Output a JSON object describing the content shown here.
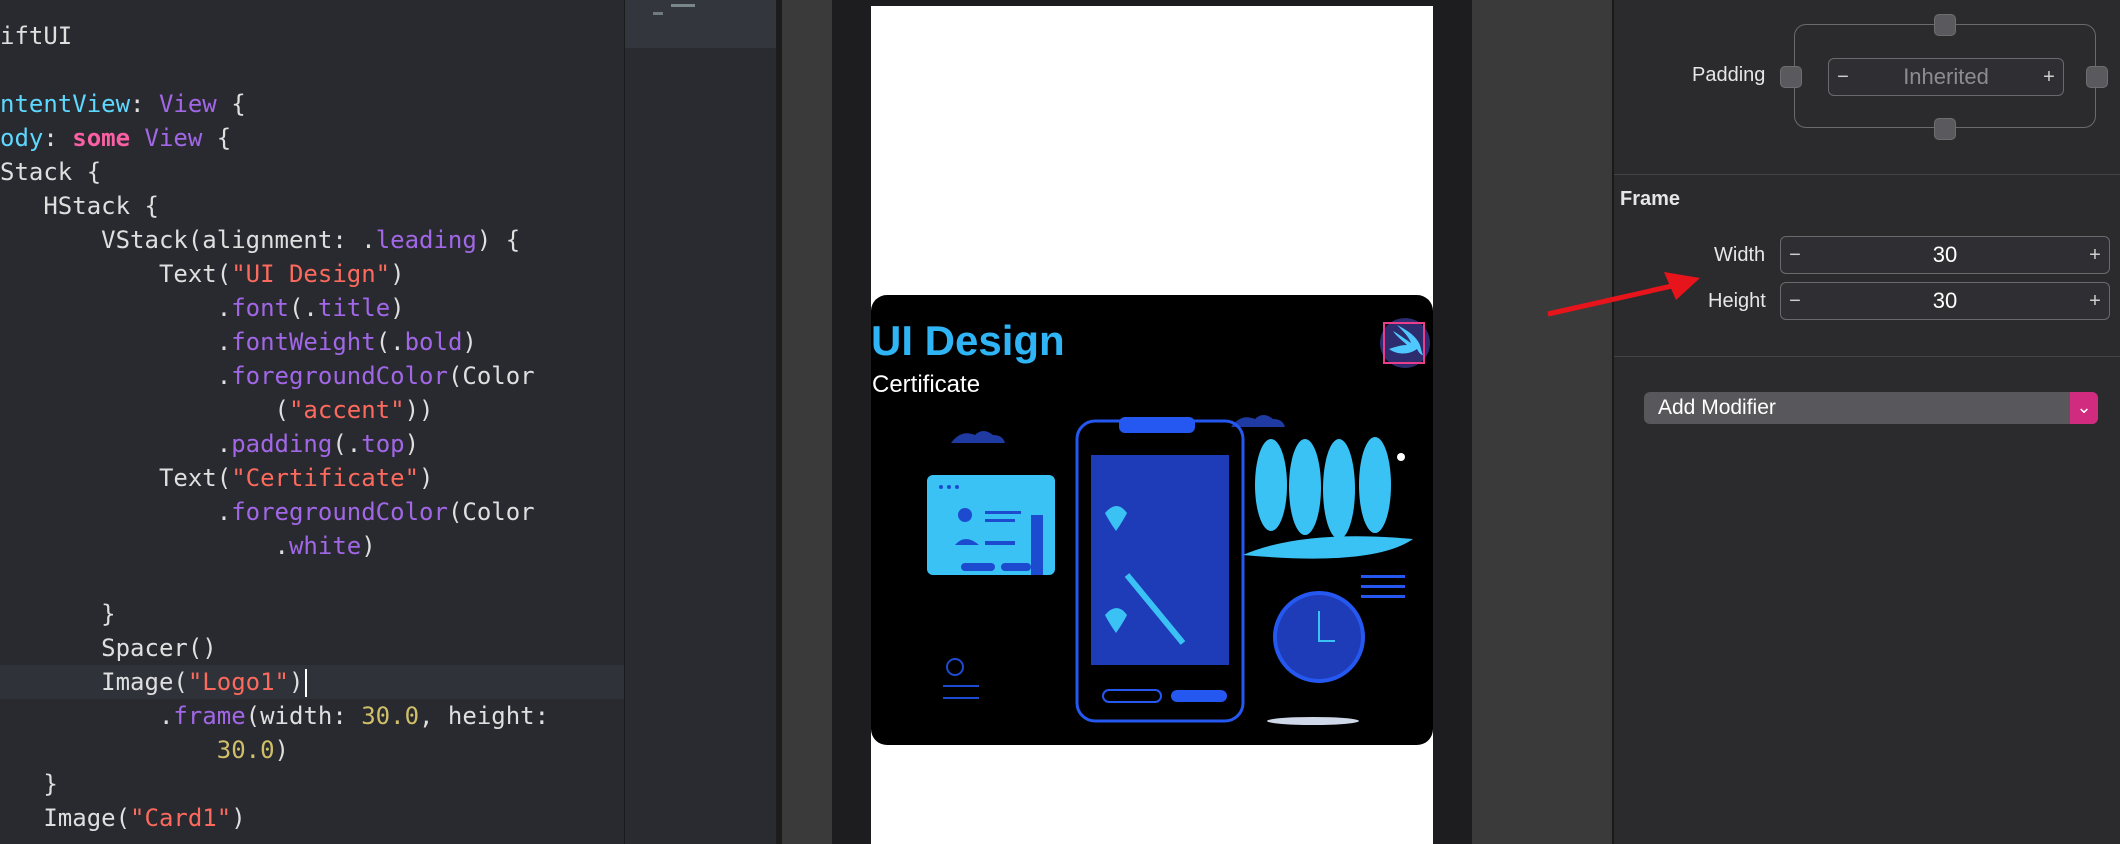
{
  "editor": {
    "lines": [
      {
        "segments": [
          {
            "t": "iftUI",
            "c": ""
          }
        ]
      },
      {
        "segments": []
      },
      {
        "segments": [
          {
            "t": "ntentView",
            "c": "ty"
          },
          {
            "t": ": ",
            "c": ""
          },
          {
            "t": "View",
            "c": "fn"
          },
          {
            "t": " {",
            "c": ""
          }
        ]
      },
      {
        "segments": [
          {
            "t": "ody",
            "c": "ty"
          },
          {
            "t": ": ",
            "c": ""
          },
          {
            "t": "some",
            "c": "kw"
          },
          {
            "t": " ",
            "c": ""
          },
          {
            "t": "View",
            "c": "fn"
          },
          {
            "t": " {",
            "c": ""
          }
        ]
      },
      {
        "segments": [
          {
            "t": "Stack {",
            "c": ""
          }
        ]
      },
      {
        "segments": [
          {
            "t": "   HStack {",
            "c": ""
          }
        ]
      },
      {
        "segments": [
          {
            "t": "       VStack(alignment: .",
            "c": ""
          },
          {
            "t": "leading",
            "c": "fn"
          },
          {
            "t": ") {",
            "c": ""
          }
        ]
      },
      {
        "segments": [
          {
            "t": "           Text(",
            "c": ""
          },
          {
            "t": "\"UI Design\"",
            "c": "str"
          },
          {
            "t": ")",
            "c": ""
          }
        ]
      },
      {
        "segments": [
          {
            "t": "               .",
            "c": ""
          },
          {
            "t": "font",
            "c": "fn"
          },
          {
            "t": "(.",
            "c": ""
          },
          {
            "t": "title",
            "c": "fn"
          },
          {
            "t": ")",
            "c": ""
          }
        ]
      },
      {
        "segments": [
          {
            "t": "               .",
            "c": ""
          },
          {
            "t": "fontWeight",
            "c": "fn"
          },
          {
            "t": "(.",
            "c": ""
          },
          {
            "t": "bold",
            "c": "fn"
          },
          {
            "t": ")",
            "c": ""
          }
        ]
      },
      {
        "segments": [
          {
            "t": "               .",
            "c": ""
          },
          {
            "t": "foregroundColor",
            "c": "fn"
          },
          {
            "t": "(Color",
            "c": ""
          }
        ]
      },
      {
        "segments": [
          {
            "t": "                   (",
            "c": ""
          },
          {
            "t": "\"accent\"",
            "c": "str"
          },
          {
            "t": "))",
            "c": ""
          }
        ]
      },
      {
        "segments": [
          {
            "t": "               .",
            "c": ""
          },
          {
            "t": "padding",
            "c": "fn"
          },
          {
            "t": "(.",
            "c": ""
          },
          {
            "t": "top",
            "c": "fn"
          },
          {
            "t": ")",
            "c": ""
          }
        ]
      },
      {
        "segments": [
          {
            "t": "           Text(",
            "c": ""
          },
          {
            "t": "\"Certificate\"",
            "c": "str"
          },
          {
            "t": ")",
            "c": ""
          }
        ]
      },
      {
        "segments": [
          {
            "t": "               .",
            "c": ""
          },
          {
            "t": "foregroundColor",
            "c": "fn"
          },
          {
            "t": "(Color",
            "c": ""
          }
        ]
      },
      {
        "segments": [
          {
            "t": "                   .",
            "c": ""
          },
          {
            "t": "white",
            "c": "fn"
          },
          {
            "t": ")",
            "c": ""
          }
        ]
      },
      {
        "segments": []
      },
      {
        "segments": [
          {
            "t": "       }",
            "c": ""
          }
        ]
      },
      {
        "segments": [
          {
            "t": "       Spacer()",
            "c": ""
          }
        ]
      },
      {
        "segments": [
          {
            "t": "       Image(",
            "c": ""
          },
          {
            "t": "\"Logo1\"",
            "c": "str"
          },
          {
            "t": ")",
            "c": ""
          }
        ],
        "current": true
      },
      {
        "segments": [
          {
            "t": "           .",
            "c": ""
          },
          {
            "t": "frame",
            "c": "fn"
          },
          {
            "t": "(width: ",
            "c": ""
          },
          {
            "t": "30.0",
            "c": "num"
          },
          {
            "t": ", height:",
            "c": ""
          }
        ]
      },
      {
        "segments": [
          {
            "t": "               ",
            "c": ""
          },
          {
            "t": "30.0",
            "c": "num"
          },
          {
            "t": ")",
            "c": ""
          }
        ]
      },
      {
        "segments": [
          {
            "t": "   }",
            "c": ""
          }
        ]
      },
      {
        "segments": [
          {
            "t": "   Image(",
            "c": ""
          },
          {
            "t": "\"Card1\"",
            "c": "str"
          },
          {
            "t": ")",
            "c": ""
          }
        ]
      }
    ]
  },
  "preview": {
    "card_title": "UI Design",
    "card_subtitle": "Certificate",
    "accent_color": "#2fb5f5",
    "logo_icon": "swift-bird-icon"
  },
  "inspector": {
    "padding": {
      "label": "Padding",
      "placeholder": "Inherited",
      "minus": "−",
      "plus": "+"
    },
    "frame": {
      "title": "Frame",
      "width_label": "Width",
      "width_value": "30",
      "height_label": "Height",
      "height_value": "30",
      "minus": "−",
      "plus": "+"
    },
    "add_modifier": {
      "label": "Add Modifier",
      "chevron": "⌄"
    },
    "annotation_color": "#e8141b"
  }
}
